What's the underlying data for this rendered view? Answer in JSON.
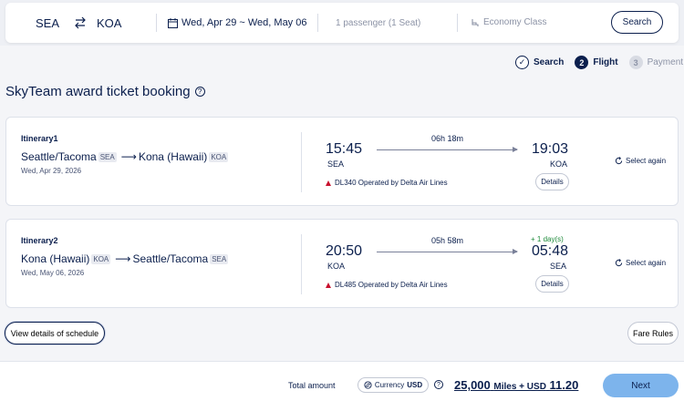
{
  "search": {
    "from": "SEA",
    "to": "KOA",
    "dates": "Wed, Apr 29 ~ Wed, May 06",
    "passengers": "1 passenger (1 Seat)",
    "cabin": "Economy Class",
    "button": "Search"
  },
  "steps": [
    {
      "num": "✓",
      "label": "Search",
      "state": "done"
    },
    {
      "num": "2",
      "label": "Flight",
      "state": "active"
    },
    {
      "num": "3",
      "label": "Payment",
      "state": "pending"
    }
  ],
  "page_title": "SkyTeam award ticket booking",
  "itineraries": [
    {
      "label": "Itinerary1",
      "from_city": "Seattle/Tacoma",
      "from_code": "SEA",
      "to_city": "Kona (Hawaii)",
      "to_code": "KOA",
      "date": "Wed, Apr 29, 2026",
      "dep_time": "15:45",
      "dep_code": "SEA",
      "duration": "06h 18m",
      "arr_time": "19:03",
      "arr_code": "KOA",
      "plus_day": "",
      "operated": "DL340 Operated by Delta Air Lines",
      "details": "Details",
      "select_again": "Select again"
    },
    {
      "label": "Itinerary2",
      "from_city": "Kona (Hawaii)",
      "from_code": "KOA",
      "to_city": "Seattle/Tacoma",
      "to_code": "SEA",
      "date": "Wed, May 06, 2026",
      "dep_time": "20:50",
      "dep_code": "KOA",
      "duration": "05h 58m",
      "arr_time": "05:48",
      "arr_code": "SEA",
      "plus_day": "+ 1 day(s)",
      "operated": "DL485 Operated by Delta Air Lines",
      "details": "Details",
      "select_again": "Select again"
    }
  ],
  "view_details": "View details of schedule",
  "fare_rules": "Fare Rules",
  "footer": {
    "total_label": "Total amount",
    "currency_label": "Currency",
    "currency_value": "USD",
    "miles": "25,000",
    "miles_unit": "Miles + USD",
    "usd": "11.20",
    "next": "Next"
  },
  "colors": {
    "navy": "#0b1f4d",
    "next_button": "#7db4ec",
    "plus_day": "#1d8a3a",
    "delta_red": "#c8102e"
  }
}
